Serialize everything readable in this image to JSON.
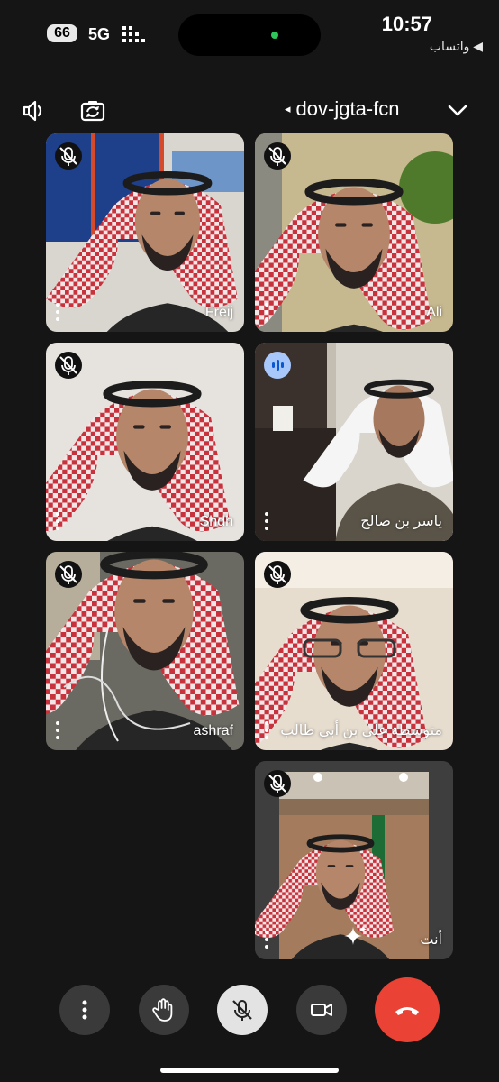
{
  "status_bar": {
    "battery": "66",
    "network": "5G",
    "time": "10:57",
    "back_app": "◀ واتساب"
  },
  "meeting": {
    "code": "dov-jgta-fcn",
    "code_arrow": "◂"
  },
  "participants": [
    {
      "name": "Freij",
      "mic": "muted"
    },
    {
      "name": "Ali",
      "mic": "muted"
    },
    {
      "name": "Shdh",
      "mic": "muted"
    },
    {
      "name": "ياسر بن صالح",
      "mic": "speaking"
    },
    {
      "name": "ashraf",
      "mic": "muted"
    },
    {
      "name": "متوسطة علي بن أبي طالب",
      "mic": "muted"
    },
    {
      "name": "أنت",
      "mic": "muted"
    }
  ],
  "controls": [
    "more-options",
    "raise-hand",
    "microphone",
    "camera",
    "end-call"
  ],
  "colors": {
    "background": "#151515",
    "control": "#3a3a3a",
    "end_call": "#ea4335",
    "speaking_badge": "#a8c7fa"
  }
}
